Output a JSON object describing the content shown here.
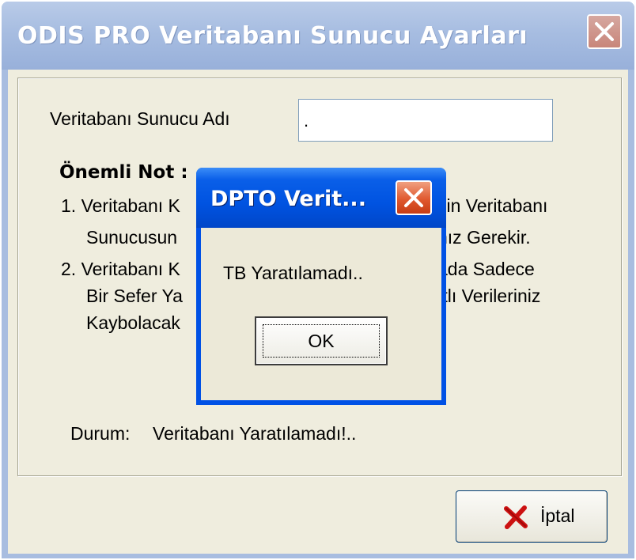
{
  "window": {
    "title": "ODIS PRO Veritabanı Sunucu Ayarları"
  },
  "form": {
    "server_label": "Veritabanı Sunucu Adı",
    "server_value": ".",
    "note_title": "Önemli Not :",
    "note_lines": [
      "1. Veritabanı K",
      "çin Veritabanı",
      "Sunucusun",
      "nız Gerekir.",
      "2. Veritabanı K",
      "ada Sadece",
      "Bir Sefer Ya",
      "ıtlı Verileriniz",
      "Kaybolacak"
    ],
    "status_label": "Durum:",
    "status_value": "Veritabanı Yaratılamadı!.."
  },
  "buttons": {
    "cancel_label": "İptal"
  },
  "dialog": {
    "title": "DPTO Verit...",
    "message": "TB Yaratılamadı..",
    "ok_label": "OK"
  },
  "icons": {
    "close": "close-icon",
    "cancel": "red-x-icon"
  },
  "colors": {
    "inactive_titlebar": "#a7bde1",
    "active_titlebar": "#0053e1",
    "dialog_close": "#e0592f",
    "cancel_x": "#cc1111"
  }
}
